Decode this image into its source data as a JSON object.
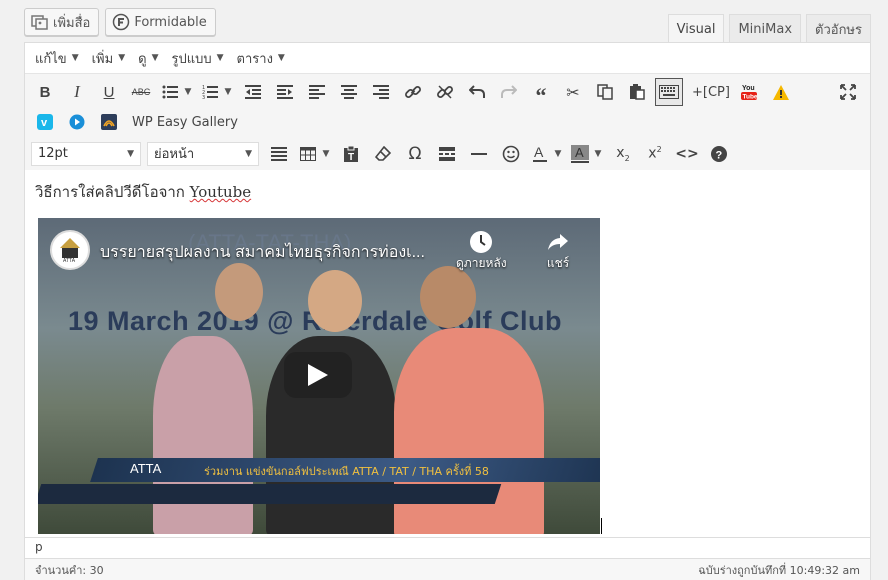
{
  "media_buttons": [
    {
      "label": "เพิ่มสื่อ",
      "icon": "add-media-icon"
    },
    {
      "label": "Formidable",
      "icon": "formidable-icon"
    }
  ],
  "tabs": {
    "visual": "Visual",
    "minimax": "MiniMax",
    "text": "ตัวอักษร",
    "active": "visual"
  },
  "menubar": [
    {
      "label": "แก้ไข"
    },
    {
      "label": "เพิ่ม"
    },
    {
      "label": "ดู"
    },
    {
      "label": "รูปแบบ"
    },
    {
      "label": "ตาราง"
    }
  ],
  "toolbar": {
    "cp_label": "+[CP]",
    "wp_gallery_label": "WP Easy Gallery",
    "font_size": "12pt",
    "paragraph_format": "ย่อหน้า"
  },
  "content": {
    "text_prefix": "วิธีการใส่คลิปวีดีโอจาก ",
    "text_link": "Youtube"
  },
  "video": {
    "title": "บรรยายสรุปผลงาน สมาคมไทยธุรกิจการท่องเ...",
    "watch_later": "ดูภายหลัง",
    "share": "แชร์",
    "banner_date": "19 March 2019 @ Riverdale Golf Club",
    "banner_top": "(ATTA-TAT-THA)",
    "lower_label": "ATTA",
    "lower_sub": "ร่วมงาน แข่งขันกอล์ฟประเพณี ATTA / TAT / THA ครั้งที่ 58"
  },
  "status": {
    "path": "p",
    "word_count": "จำนวนคำ: 30",
    "draft_saved": "ฉบับร่างถูกบันทึกที่ 10:49:32 am"
  },
  "colors": {
    "border": "#dddddd",
    "toolbar_bg": "#f5f5f5",
    "youtube_red": "#e62117",
    "vimeo_blue": "#1ab7ea",
    "warning_yellow": "#f5b800"
  }
}
